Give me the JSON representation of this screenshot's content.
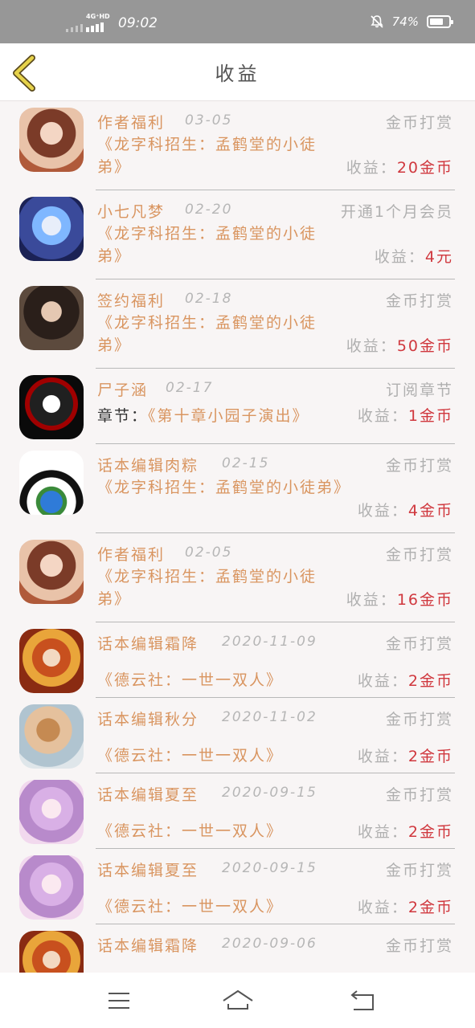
{
  "status_bar": {
    "network": "4G⁺HD",
    "time": "09:02",
    "battery_percent": "74%",
    "battery_level": 0.74
  },
  "header": {
    "title": "收益"
  },
  "earnings_label": "收益：",
  "chapter_label": "章节：",
  "items": [
    {
      "name": "作者福利",
      "date": "03-05",
      "type": "金币打赏",
      "book": "《龙字科招生：孟鹤堂的小徒弟》",
      "amount": "20金币"
    },
    {
      "name": "小七凡梦",
      "date": "02-20",
      "type": "开通1个月会员",
      "book": "《龙字科招生：孟鹤堂的小徒弟》",
      "amount": "4元"
    },
    {
      "name": "签约福利",
      "date": "02-18",
      "type": "金币打赏",
      "book": "《龙字科招生：孟鹤堂的小徒弟》",
      "amount": "50金币"
    },
    {
      "name": "尸子涵",
      "date": "02-17",
      "type": "订阅章节",
      "chapter": "《第十章小园子演出》",
      "amount": "1金币"
    },
    {
      "name": "话本编辑肉粽",
      "date": "02-15",
      "type": "金币打赏",
      "book": "《龙字科招生：孟鹤堂的小徒弟》",
      "amount": "4金币"
    },
    {
      "name": "作者福利",
      "date": "02-05",
      "type": "金币打赏",
      "book": "《龙字科招生：孟鹤堂的小徒弟》",
      "amount": "16金币"
    },
    {
      "name": "话本编辑霜降",
      "date": "2020-11-09",
      "type": "金币打赏",
      "book": "《德云社：一世一双人》",
      "amount": "2金币"
    },
    {
      "name": "话本编辑秋分",
      "date": "2020-11-02",
      "type": "金币打赏",
      "book": "《德云社：一世一双人》",
      "amount": "2金币"
    },
    {
      "name": "话本编辑夏至",
      "date": "2020-09-15",
      "type": "金币打赏",
      "book": "《德云社：一世一双人》",
      "amount": "2金币"
    },
    {
      "name": "话本编辑夏至",
      "date": "2020-09-15",
      "type": "金币打赏",
      "book": "《德云社：一世一双人》",
      "amount": "2金币"
    },
    {
      "name": "话本编辑霜降",
      "date": "2020-09-06",
      "type": "金币打赏"
    }
  ],
  "colors": {
    "accent_text": "#d99560",
    "amount_red": "#d0383e",
    "muted": "#b0b0b0",
    "status_bar": "#979797",
    "back_arrow": "#e6d24a"
  }
}
